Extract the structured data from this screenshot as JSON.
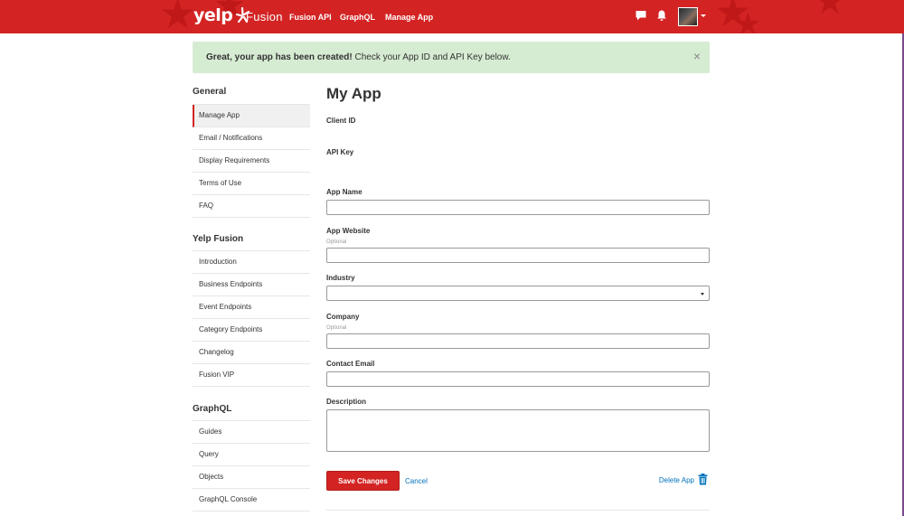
{
  "header": {
    "logo_text": "yelp",
    "product_title": "Fusion",
    "nav": [
      {
        "label": "Fusion API"
      },
      {
        "label": "GraphQL"
      },
      {
        "label": "Manage App"
      }
    ],
    "icons": [
      "message-icon",
      "bell-icon",
      "avatar",
      "chevron-down-icon"
    ],
    "brand_color": "#d32323"
  },
  "alert": {
    "bold_text": "Great, your app has been created!",
    "text": " Check your App ID and API Key below.",
    "close_label": "×",
    "background": "#d6ecd2"
  },
  "sidebar": {
    "sections": [
      {
        "heading": "General",
        "items": [
          {
            "label": "Manage App",
            "active": true
          },
          {
            "label": "Email / Notifications"
          },
          {
            "label": "Display Requirements"
          },
          {
            "label": "Terms of Use"
          },
          {
            "label": "FAQ"
          }
        ]
      },
      {
        "heading": "Yelp Fusion",
        "items": [
          {
            "label": "Introduction"
          },
          {
            "label": "Business Endpoints"
          },
          {
            "label": "Event Endpoints"
          },
          {
            "label": "Category Endpoints"
          },
          {
            "label": "Changelog"
          },
          {
            "label": "Fusion VIP"
          }
        ]
      },
      {
        "heading": "GraphQL",
        "items": [
          {
            "label": "Guides"
          },
          {
            "label": "Query"
          },
          {
            "label": "Objects"
          },
          {
            "label": "GraphQL Console"
          }
        ]
      }
    ]
  },
  "main": {
    "title": "My App",
    "client_id_label": "Client ID",
    "client_id_value": "",
    "api_key_label": "API Key",
    "api_key_value": "",
    "app_name_label": "App Name",
    "app_name_value": "",
    "app_website_label": "App Website",
    "app_website_sub": "Optional",
    "app_website_value": "",
    "industry_label": "Industry",
    "industry_value": "",
    "company_label": "Company",
    "company_sub": "Optional",
    "company_value": "",
    "contact_email_label": "Contact Email",
    "contact_email_value": "",
    "description_label": "Description",
    "description_value": "",
    "save_label": "Save Changes",
    "cancel_label": "Cancel",
    "delete_label": "Delete App"
  }
}
